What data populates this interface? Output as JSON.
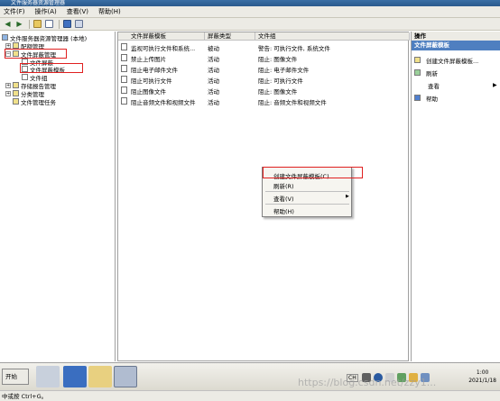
{
  "window": {
    "title": "文件服务器资源管理器"
  },
  "menu": {
    "items": [
      "文件(F)",
      "操作(A)",
      "查看(V)",
      "帮助(H)"
    ]
  },
  "tree": {
    "root": "文件服务器资源管理器 (本地)",
    "items": [
      "配额管理",
      "文件屏蔽管理",
      "文件屏蔽",
      "文件屏蔽模板",
      "文件组",
      "存储报告管理",
      "分类管理",
      "文件管理任务"
    ]
  },
  "table": {
    "columns": [
      "文件屏蔽模板",
      "屏蔽类型",
      "文件组"
    ],
    "rows": [
      [
        "监视可执行文件和系统...",
        "被动",
        "警告: 可执行文件, 系统文件"
      ],
      [
        "禁止上传图片",
        "活动",
        "阻止: 图像文件"
      ],
      [
        "阻止电子邮件文件",
        "活动",
        "阻止: 电子邮件文件"
      ],
      [
        "阻止可执行文件",
        "活动",
        "阻止: 可执行文件"
      ],
      [
        "阻止图像文件",
        "活动",
        "阻止: 图像文件"
      ],
      [
        "阻止音频文件和视频文件",
        "活动",
        "阻止: 音频文件和视频文件"
      ]
    ]
  },
  "context_menu": {
    "items": [
      "创建文件屏蔽模板(C)...",
      "刷新(R)",
      "查看(V)",
      "帮助(H)"
    ]
  },
  "operations": {
    "title": "操作",
    "section": "文件屏蔽模板",
    "items": [
      "创建文件屏蔽模板...",
      "刷新",
      "查看",
      "帮助"
    ]
  },
  "taskbar": {
    "start": "开始",
    "time": "1:00",
    "date": "2021/1/18",
    "lang": "CH"
  },
  "statusbar": {
    "text": "中或按 Ctrl+G。"
  },
  "watermark": "https://blog.csdn.net/zzy1..."
}
